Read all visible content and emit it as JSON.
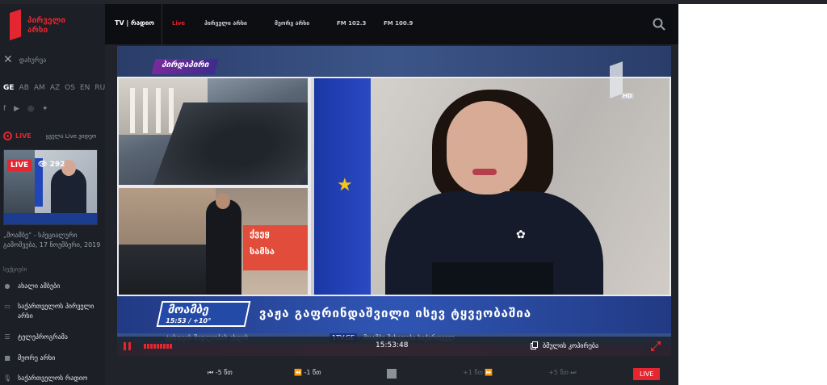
{
  "logo": {
    "text": "პირველი არხი"
  },
  "header": {
    "tv_radio": "TV | რადიო",
    "links": [
      "Live",
      "პირველი არხი",
      "მეორე არხი",
      "FM 102.3",
      "FM 100.9"
    ]
  },
  "sidebar": {
    "close_label": "დახურვა",
    "languages": [
      "GE",
      "AB",
      "AM",
      "AZ",
      "OS",
      "EN",
      "RU"
    ],
    "socials": [
      "f",
      "▶",
      "◎",
      "✦"
    ],
    "live_label": "LIVE",
    "all_live": "ყველა Live ვიდეო",
    "thumbnail": {
      "badge": "LIVE",
      "views": "292"
    },
    "caption": "„მოამბე“ - სპეციალური გამოშვება, 17 ნოემბერი, 2019",
    "section_title": "სექციები",
    "items": [
      {
        "icon": "globe-icon",
        "label": "ახალი ამბები"
      },
      {
        "icon": "tv-icon",
        "label": "საქართველოს პირველი არხი"
      },
      {
        "icon": "list-icon",
        "label": "ტელეპროგრამა"
      },
      {
        "icon": "camera-icon",
        "label": "მეორე არხი"
      },
      {
        "icon": "mic-icon",
        "label": "საქართველოს რადიო"
      }
    ]
  },
  "video": {
    "tag": "პირდაპირი",
    "hd_label": "HD",
    "sign_text_1": "ქვეყ",
    "sign_text_2": "სამსა",
    "lower_third": {
      "brand": "მოამბე",
      "info": "15:53 / +10°",
      "headline": "ვაჟა გაფრინდაშვილი ისევ ტყვეობაშია"
    },
    "ticker": "ტისთვის მადლობას ეხდის",
    "ticker_site": "1TV.GE",
    "ticker_after": "მოამბე შეხვდება საქართველ"
  },
  "controls": {
    "time": "15:53:48",
    "copy_link": "ბმულის კოპირება",
    "seek": [
      "-5 წთ",
      "-1 წთ",
      "+1 წთ",
      "+5 წთ"
    ],
    "live_button": "LIVE"
  },
  "colors": {
    "accent": "#e3262f",
    "sidebar": "#1c1f26",
    "header": "#0d0e11"
  }
}
